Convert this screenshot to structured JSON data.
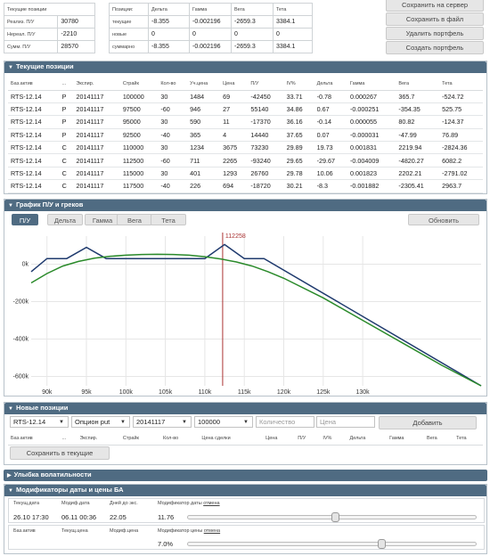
{
  "summary1": {
    "title": "Текущие позиции",
    "rows": [
      {
        "label": "Реализ. П/У",
        "value": "30780"
      },
      {
        "label": "Нереал. П/У",
        "value": "-2210"
      },
      {
        "label": "Сумм. П/У",
        "value": "28570"
      }
    ]
  },
  "summary2": {
    "headers": [
      "Позиции:",
      "Дельта",
      "Гамма",
      "Вега",
      "Тета"
    ],
    "rows": [
      [
        "текущие",
        "-8.355",
        "-0.002196",
        "-2659.3",
        "3384.1"
      ],
      [
        "новые",
        "0",
        "0",
        "0",
        "0"
      ],
      [
        "суммарно",
        "-8.355",
        "-0.002196",
        "-2659.3",
        "3384.1"
      ]
    ]
  },
  "actions": {
    "save_server": "Сохранить на сервер",
    "save_file": "Сохранить в файл",
    "delete_portfolio": "Удалить портфель",
    "create_portfolio": "Создать портфель"
  },
  "positions": {
    "title": "Текущие позиции",
    "headers": [
      "Баз.актив",
      "...",
      "Экспир.",
      "Страйк",
      "Кол-во",
      "Уч.цена",
      "Цена",
      "П/У",
      "IV%",
      "Дельта",
      "Гамма",
      "Вега",
      "Тета"
    ],
    "rows": [
      [
        "RTS-12.14",
        "P",
        "20141117",
        "100000",
        "30",
        "1484",
        "69",
        "-42450",
        "33.71",
        "-0.78",
        "0.000267",
        "365.7",
        "-524.72"
      ],
      [
        "RTS-12.14",
        "P",
        "20141117",
        "97500",
        "-60",
        "946",
        "27",
        "55140",
        "34.86",
        "0.67",
        "-0.000251",
        "-354.35",
        "525.75"
      ],
      [
        "RTS-12.14",
        "P",
        "20141117",
        "95000",
        "30",
        "590",
        "11",
        "-17370",
        "36.16",
        "-0.14",
        "0.000055",
        "80.82",
        "-124.37"
      ],
      [
        "RTS-12.14",
        "P",
        "20141117",
        "92500",
        "-40",
        "365",
        "4",
        "14440",
        "37.65",
        "0.07",
        "-0.000031",
        "-47.99",
        "76.89"
      ],
      [
        "RTS-12.14",
        "C",
        "20141117",
        "110000",
        "30",
        "1234",
        "3675",
        "73230",
        "29.89",
        "19.73",
        "0.001831",
        "2219.94",
        "-2824.36"
      ],
      [
        "RTS-12.14",
        "C",
        "20141117",
        "112500",
        "-60",
        "711",
        "2265",
        "-93240",
        "29.65",
        "-29.67",
        "-0.004009",
        "-4820.27",
        "6082.2"
      ],
      [
        "RTS-12.14",
        "C",
        "20141117",
        "115000",
        "30",
        "401",
        "1293",
        "26760",
        "29.78",
        "10.06",
        "0.001823",
        "2202.21",
        "-2791.02"
      ],
      [
        "RTS-12.14",
        "C",
        "20141117",
        "117500",
        "-40",
        "226",
        "694",
        "-18720",
        "30.21",
        "-8.3",
        "-0.001882",
        "-2305.41",
        "2963.7"
      ]
    ]
  },
  "graph": {
    "title": "График П/У и греков",
    "tabs": [
      "П/У",
      "Дельта",
      "Гамма",
      "Вега",
      "Тета"
    ],
    "refresh": "Обновить",
    "marker_label": "112258"
  },
  "chart_data": {
    "type": "line",
    "title": "",
    "xlim": [
      88000,
      145000
    ],
    "ylim": [
      -650000,
      150000
    ],
    "xticks": [
      90000,
      95000,
      100000,
      105000,
      110000,
      115000,
      120000,
      125000,
      130000
    ],
    "xtick_labels": [
      "90k",
      "95k",
      "100k",
      "105k",
      "110k",
      "115k",
      "120k",
      "125k",
      "130k"
    ],
    "yticks": [
      0,
      -200000,
      -400000,
      -600000
    ],
    "ytick_labels": [
      "0k",
      "-200k",
      "-400k",
      "-600k"
    ],
    "marker_x": 112258,
    "series": [
      {
        "color": "#1f3a6e",
        "x": [
          88000,
          90000,
          92500,
          95000,
          97500,
          100000,
          110000,
          112500,
          115000,
          117500,
          145000
        ],
        "y": [
          -40000,
          30000,
          30000,
          90000,
          30000,
          30000,
          30000,
          105000,
          30000,
          30000,
          -650000
        ]
      },
      {
        "color": "#2a8a2a",
        "x": [
          88000,
          90000,
          92000,
          94000,
          96000,
          98000,
          100000,
          102000,
          104000,
          106000,
          108000,
          110000,
          112000,
          114000,
          116000,
          118000,
          120000,
          125000,
          130000,
          135000,
          140000,
          145000
        ],
        "y": [
          -100000,
          -50000,
          -10000,
          15000,
          32000,
          42000,
          48000,
          52000,
          53000,
          52000,
          48000,
          40000,
          28000,
          12000,
          -10000,
          -40000,
          -75000,
          -180000,
          -300000,
          -420000,
          -540000,
          -650000
        ]
      }
    ]
  },
  "new_positions": {
    "title": "Новые позиции",
    "asset": "RTS-12.14",
    "type": "Опцион put",
    "expiry": "20141117",
    "strike": "100000",
    "qty_placeholder": "Количество",
    "price_placeholder": "Цена",
    "add": "Добавить",
    "headers": [
      "Баз.актив",
      "...",
      "Экспир.",
      "Страйк",
      "Кол-во",
      "Цена сделки",
      "Цена",
      "П/У",
      "IV%",
      "Дельта",
      "Гамма",
      "Вега",
      "Тета"
    ],
    "save_current": "Сохранить в текущие"
  },
  "smile": {
    "title": "Улыбка волатильности"
  },
  "modifiers": {
    "title": "Модификаторы даты и цены БА",
    "headers1": [
      "Текущ.дата",
      "Модиф.дата",
      "Дней до экс.",
      "Модификатор даты"
    ],
    "cancel": "отмена",
    "values1": [
      "26.10 17:30",
      "06.11 00:36",
      "22.05",
      "11.76"
    ],
    "slider1": 0.51,
    "headers2": [
      "Баз.актив",
      "Текущ.цена",
      "Модиф.цена",
      "Модификатор цены"
    ],
    "value2": "7.0%",
    "slider2": 0.67
  }
}
